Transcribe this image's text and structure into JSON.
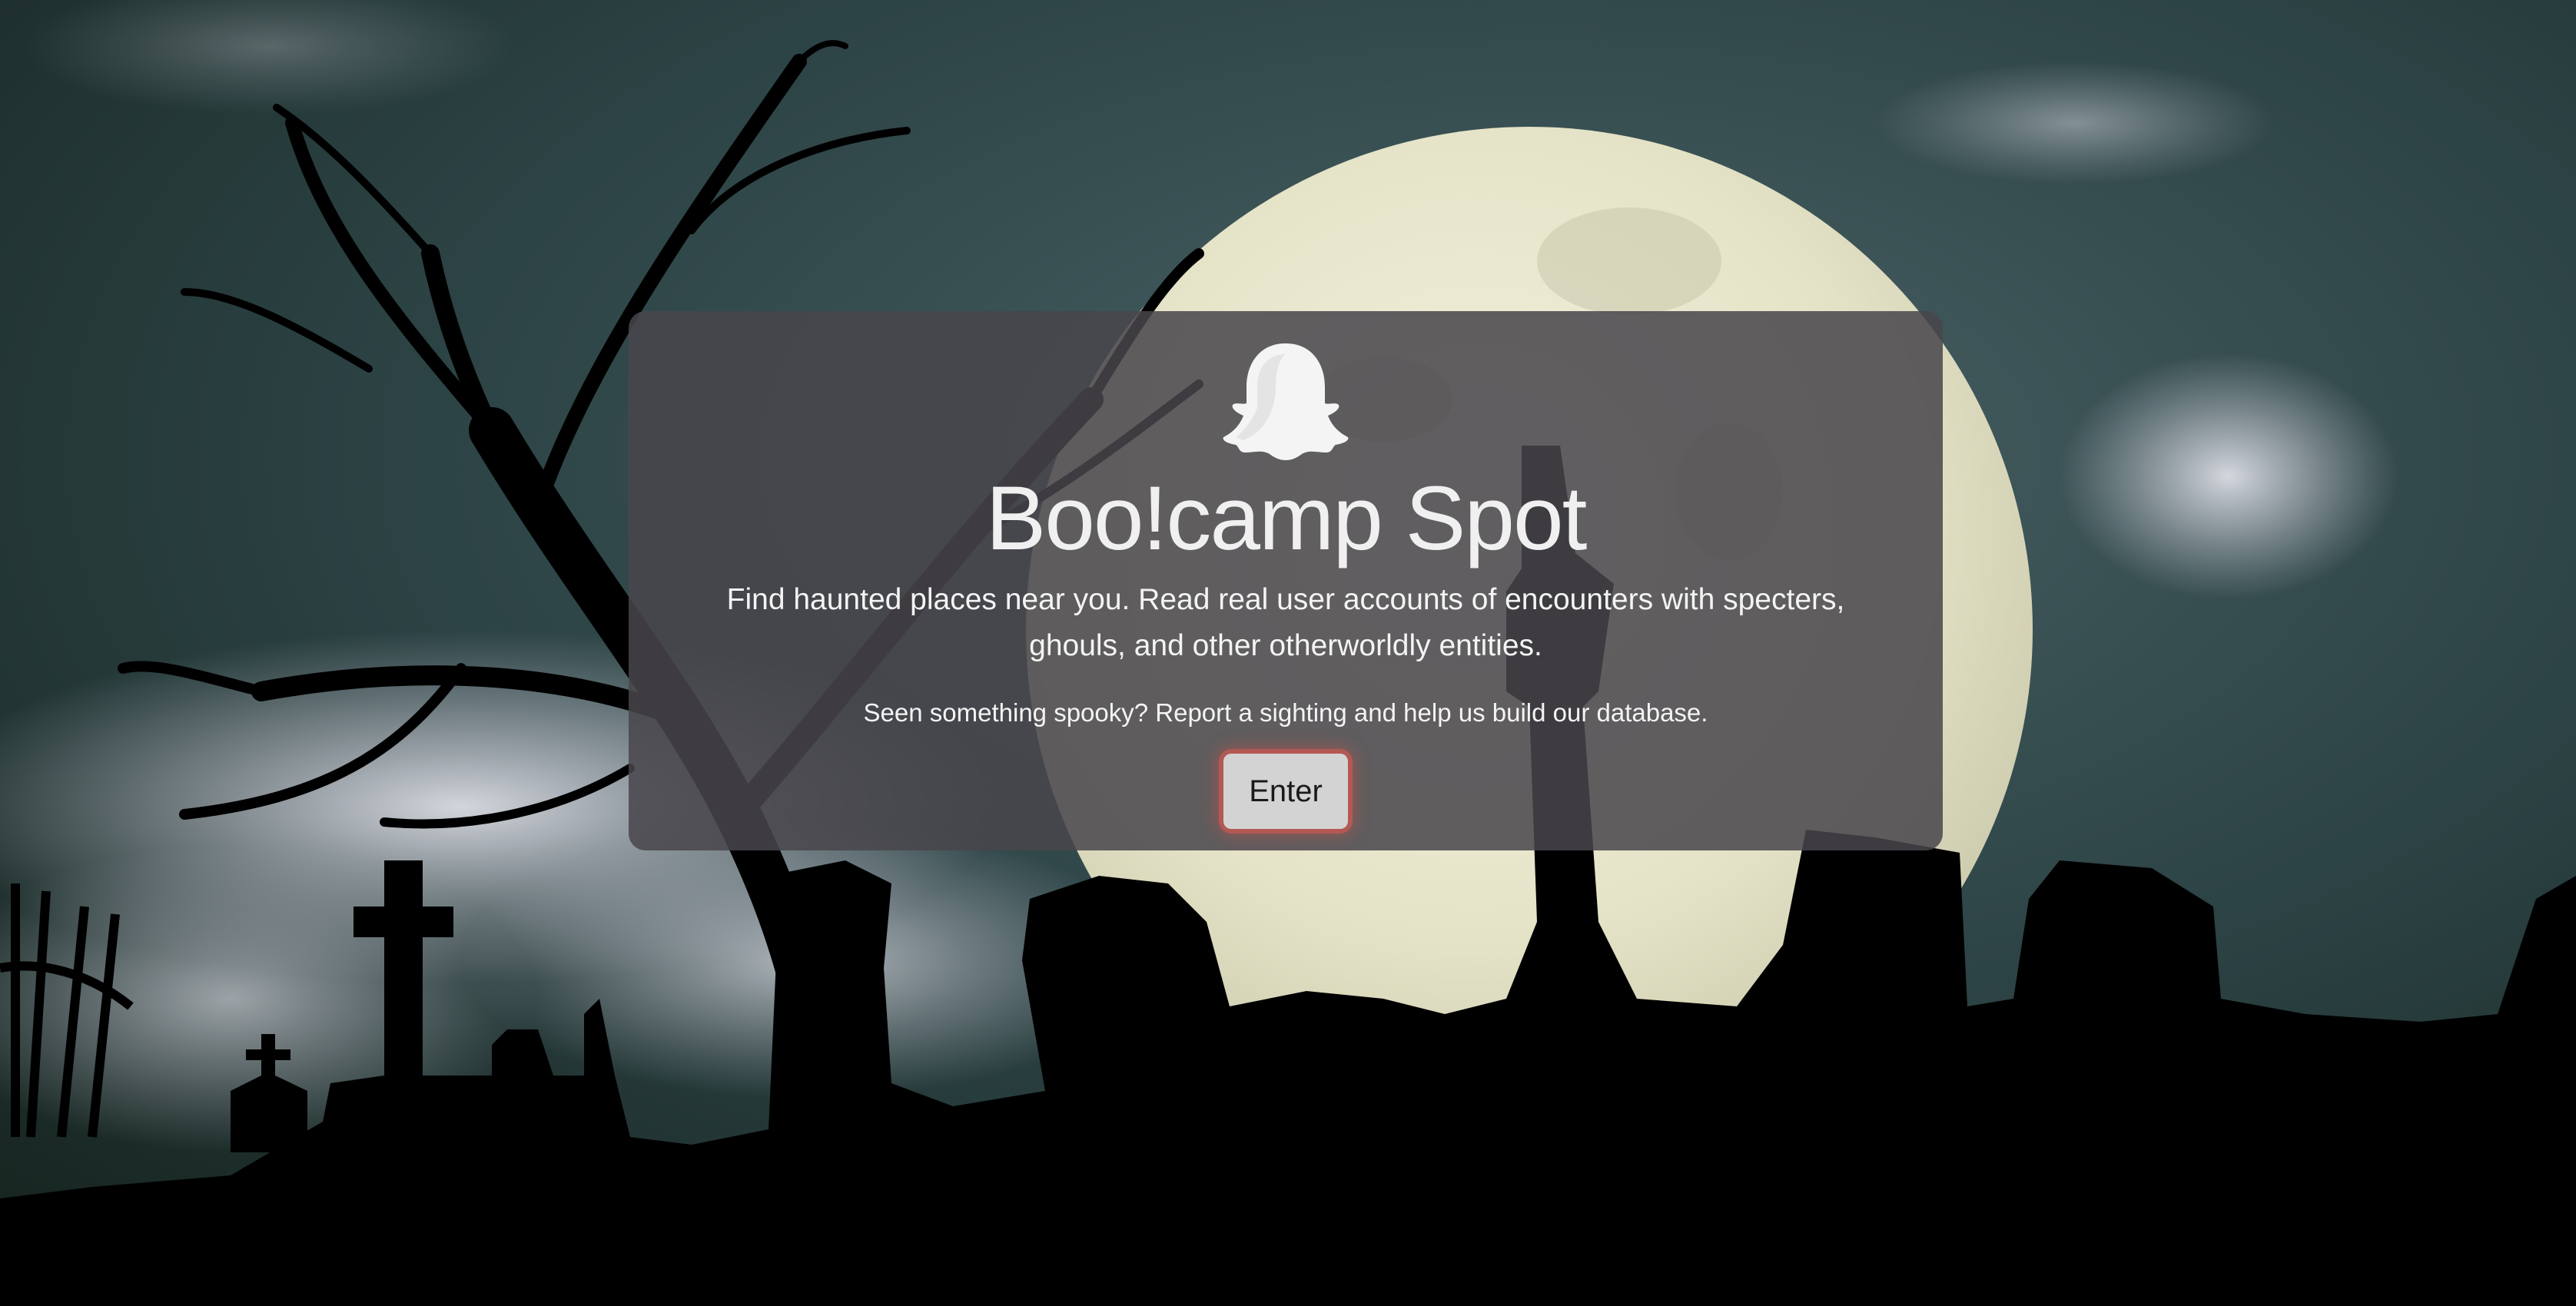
{
  "background": {
    "image_icon": "moonlit-graveyard-background",
    "sky_color": "#23383a",
    "moon_color": "#e9e8d2",
    "silhouette_color": "#000000"
  },
  "hero": {
    "logo_icon": "ghost-icon",
    "title": "Boo!camp Spot",
    "lead": "Find haunted places near you. Read real user accounts of encounters with specters, ghouls, and other otherworldly entities.",
    "cta_text": "Seen something spooky? Report a sighting and help us build our database.",
    "enter_label": "Enter",
    "card_color": "#48464c",
    "button_glow_color": "#dc5a50"
  }
}
